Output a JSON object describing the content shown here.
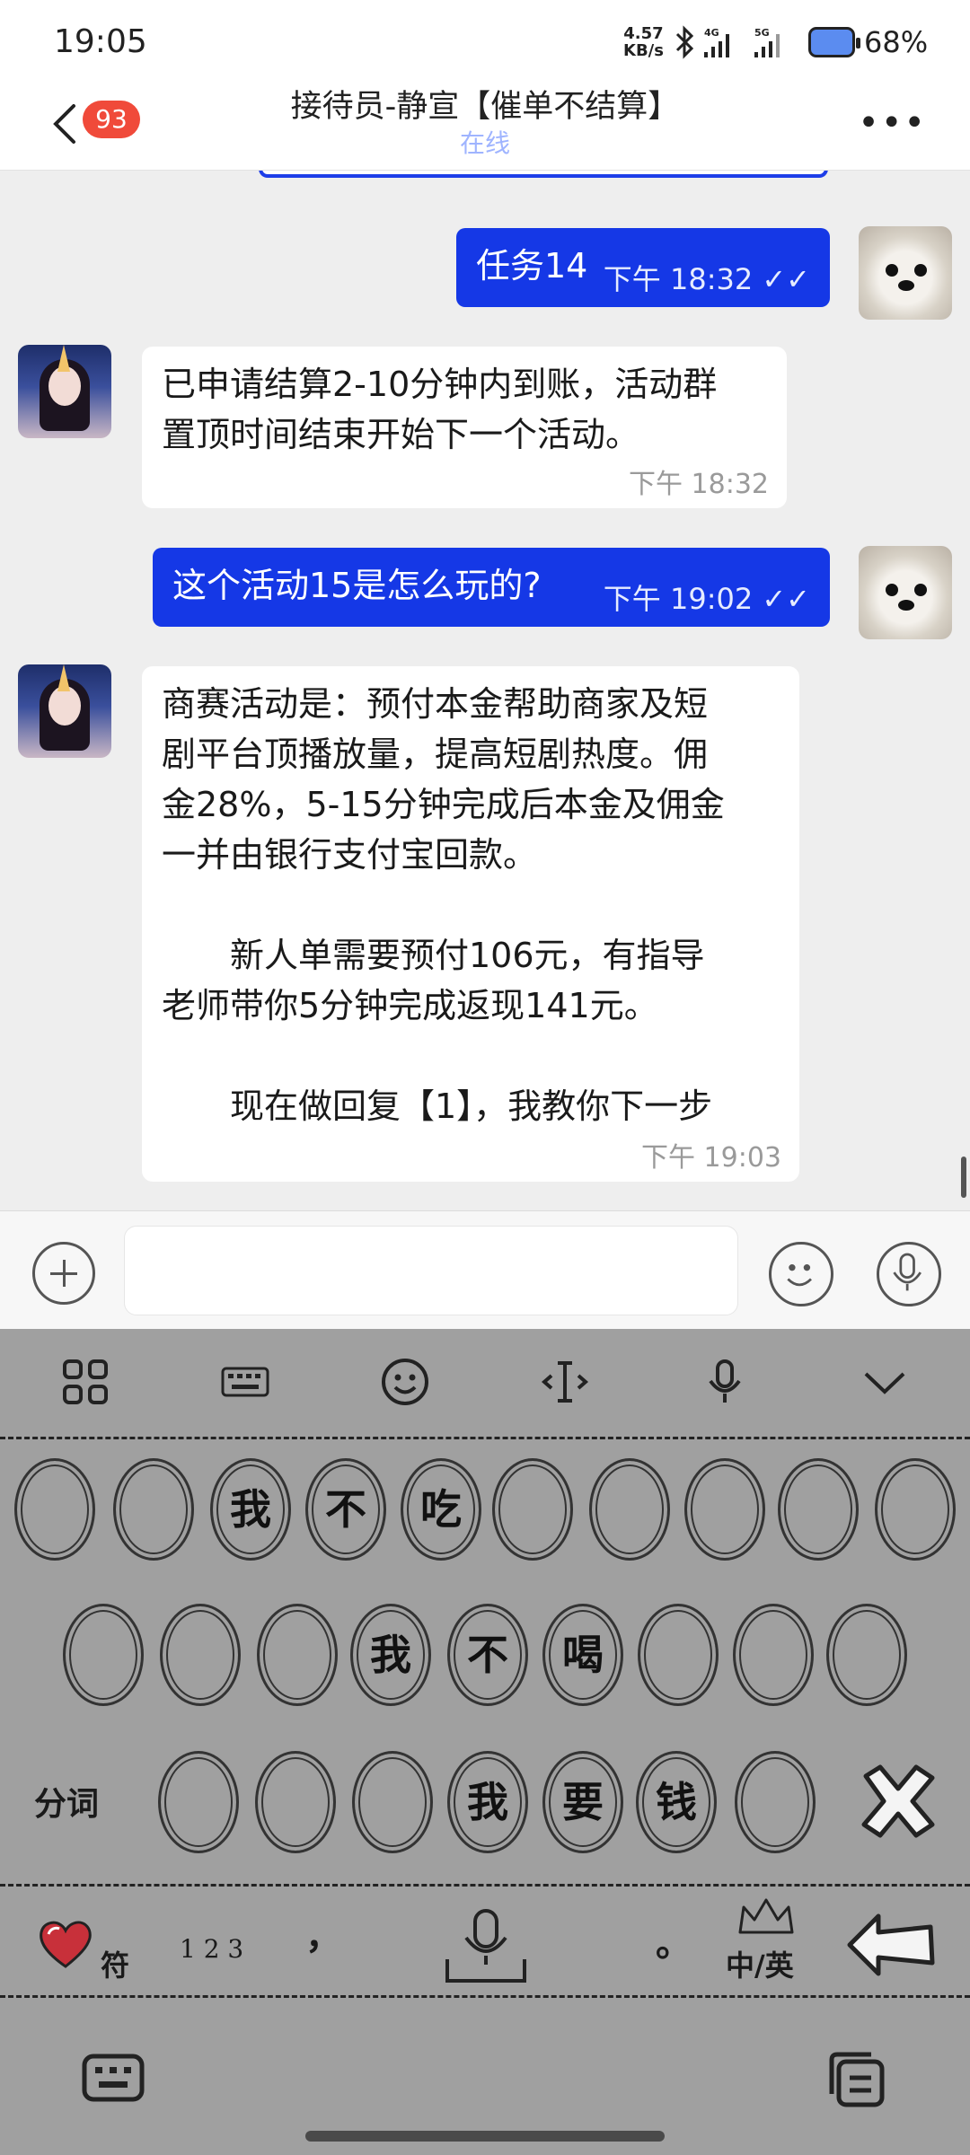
{
  "status_bar": {
    "time": "19:05",
    "net_speed_value": "4.57",
    "net_speed_unit": "KB/s",
    "battery_pct": "68%"
  },
  "header": {
    "back_badge": "93",
    "title": "接待员-静宣【催单不结算】",
    "subtitle": "在线",
    "more": "•••"
  },
  "messages": [
    {
      "direction": "out",
      "text": "任务14",
      "meta": "下午  18:32 ✓✓"
    },
    {
      "direction": "in",
      "text_lines": [
        "已申请结算2-10分钟内到账，活动群",
        "置顶时间结束开始下一个活动。"
      ],
      "meta": "下午  18:32"
    },
    {
      "direction": "out",
      "text": "这个活动15是怎么玩的?",
      "meta": "下午  19:02 ✓✓"
    },
    {
      "direction": "in",
      "text_lines": [
        "商赛活动是：预付本金帮助商家及短",
        "剧平台顶播放量，提高短剧热度。佣",
        "金28%，5-15分钟完成后本金及佣金",
        "一并由银行支付宝回款。",
        "",
        "　　新人单需要预付106元，有指导",
        "老师带你5分钟完成返现141元。",
        "",
        "　　现在做回复【1】，我教你下一步"
      ],
      "meta": "下午  19:03"
    }
  ],
  "keyboard": {
    "row1": [
      "",
      "",
      "我",
      "不",
      "吃",
      "",
      "",
      "",
      "",
      ""
    ],
    "row2": [
      "",
      "",
      "",
      "我",
      "不",
      "喝",
      "",
      "",
      ""
    ],
    "row3_label": "分词",
    "row3": [
      "",
      "",
      "",
      "我",
      "要",
      "钱",
      ""
    ],
    "bottom": {
      "symbol_label": "符",
      "num_label": "1 2 3",
      "comma": "，",
      "period": "。",
      "lang_label": "中/英"
    }
  },
  "icons": {
    "toolbar": [
      "grid-icon",
      "keyboard-layout-icon",
      "emoji-icon",
      "cursor-icon",
      "mic-icon",
      "collapse-icon"
    ]
  }
}
